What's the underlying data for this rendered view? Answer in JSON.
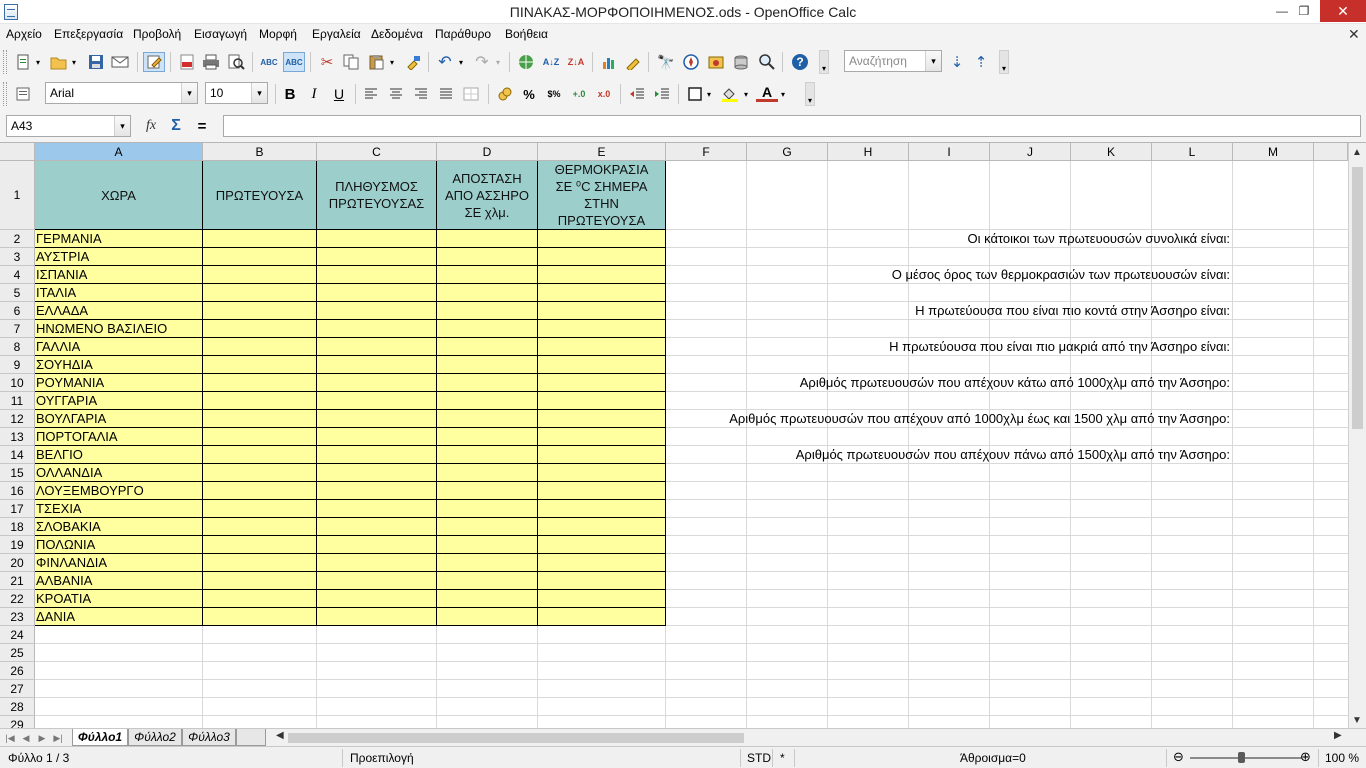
{
  "window": {
    "title": "ΠΙΝΑΚΑΣ-ΜΟΡΦΟΠΟΙΗΜΕΝΟΣ.ods - OpenOffice Calc",
    "minimize": "—",
    "maximize": "❐",
    "close": "✕"
  },
  "menu": [
    "Αρχείο",
    "Επεξεργασία",
    "Προβολή",
    "Εισαγωγή",
    "Μορφή",
    "Εργαλεία",
    "Δεδομένα",
    "Παράθυρο",
    "Βοήθεια"
  ],
  "toolbar": {
    "search_placeholder": "Αναζήτηση",
    "font_name": "Arial",
    "font_size": "10",
    "bold": "B",
    "italic": "I",
    "underline": "U",
    "percent": "%",
    "font_color_letter": "A"
  },
  "formula_bar": {
    "name_box": "A43",
    "function_wizard": "fx",
    "sum": "Σ",
    "equals": "=",
    "content": ""
  },
  "columns": [
    "A",
    "B",
    "C",
    "D",
    "E",
    "F",
    "G",
    "H",
    "I",
    "J",
    "K",
    "L",
    "M"
  ],
  "rows": [
    "1",
    "2",
    "3",
    "4",
    "5",
    "6",
    "7",
    "8",
    "9",
    "10",
    "11",
    "12",
    "13",
    "14",
    "15",
    "16",
    "17",
    "18",
    "19",
    "20",
    "21",
    "22",
    "23",
    "24",
    "25",
    "26",
    "27",
    "28",
    "29"
  ],
  "table": {
    "headers": [
      "ΧΩΡΑ",
      "ΠΡΩΤΕΥΟΥΣΑ",
      "ΠΛΗΘΥΣΜΟΣ\nΠΡΩΤΕΥΟΥΣΑΣ",
      "ΑΠΟΣΤΑΣΗ\nΑΠΟ ΑΣΣΗΡΟ\nΣΕ χλμ.",
      "ΘΕΡΜΟΚΡΑΣΙΑ\nΣΕ ⁰C ΣΗΜΕΡΑ\nΣΤΗΝ\nΠΡΩΤΕΥΟΥΣΑ"
    ],
    "countries": [
      "ΓΕΡΜΑΝΙΑ",
      "ΑΥΣΤΡΙΑ",
      "ΙΣΠΑΝΙΑ",
      "ΙΤΑΛΙΑ",
      "ΕΛΛΑΔΑ",
      "ΗΝΩΜΕΝΟ ΒΑΣΙΛΕΙΟ",
      "ΓΑΛΛΙΑ",
      "ΣΟΥΗΔΙΑ",
      "ΡΟΥΜΑΝΙΑ",
      "ΟΥΓΓΑΡΙΑ",
      "ΒΟΥΛΓΑΡΙΑ",
      "ΠΟΡΤΟΓΑΛΙΑ",
      "ΒΕΛΓΙΟ",
      "ΟΛΛΑΝΔΙΑ",
      "ΛΟΥΞΕΜΒΟΥΡΓΟ",
      "ΤΣΕΧΙΑ",
      "ΣΛΟΒΑΚΙΑ",
      "ΠΟΛΩΝΙΑ",
      "ΦΙΝΛΑΝΔΙΑ",
      "ΑΛΒΑΝΙΑ",
      "ΚΡΟΑΤΙΑ",
      "ΔΑΝΙΑ"
    ],
    "header_color": "#9ccfcc",
    "body_color": "#ffff9f"
  },
  "stat_labels": [
    "Οι κάτοικοι των πρωτευουσών συνολικά είναι:",
    "Ο μέσος όρος των θερμοκρασιών των πρωτευουσών είναι:",
    "Η πρωτεύουσα που είναι πιο κοντά στην Άσσηρο είναι:",
    "Η πρωτεύουσα που είναι πιο μακριά από την Άσσηρο είναι:",
    "Αριθμός πρωτευουσών που απέχουν κάτω από 1000χλμ από την Άσσηρο:",
    "Αριθμός πρωτευουσών που απέχουν από 1000χλμ  έως και 1500 χλμ από την Άσσηρο:",
    "Αριθμός πρωτευουσών που απέχουν πάνω από 1500χλμ από την Άσσηρο:"
  ],
  "sheets": [
    "Φύλλο1",
    "Φύλλο2",
    "Φύλλο3"
  ],
  "status": {
    "sheet": "Φύλλο 1 / 3",
    "style": "Προεπιλογή",
    "mode": "STD",
    "modified": "*",
    "sum": "Άθροισμα=0",
    "zoom": "100 %",
    "zoom_level": 100
  }
}
